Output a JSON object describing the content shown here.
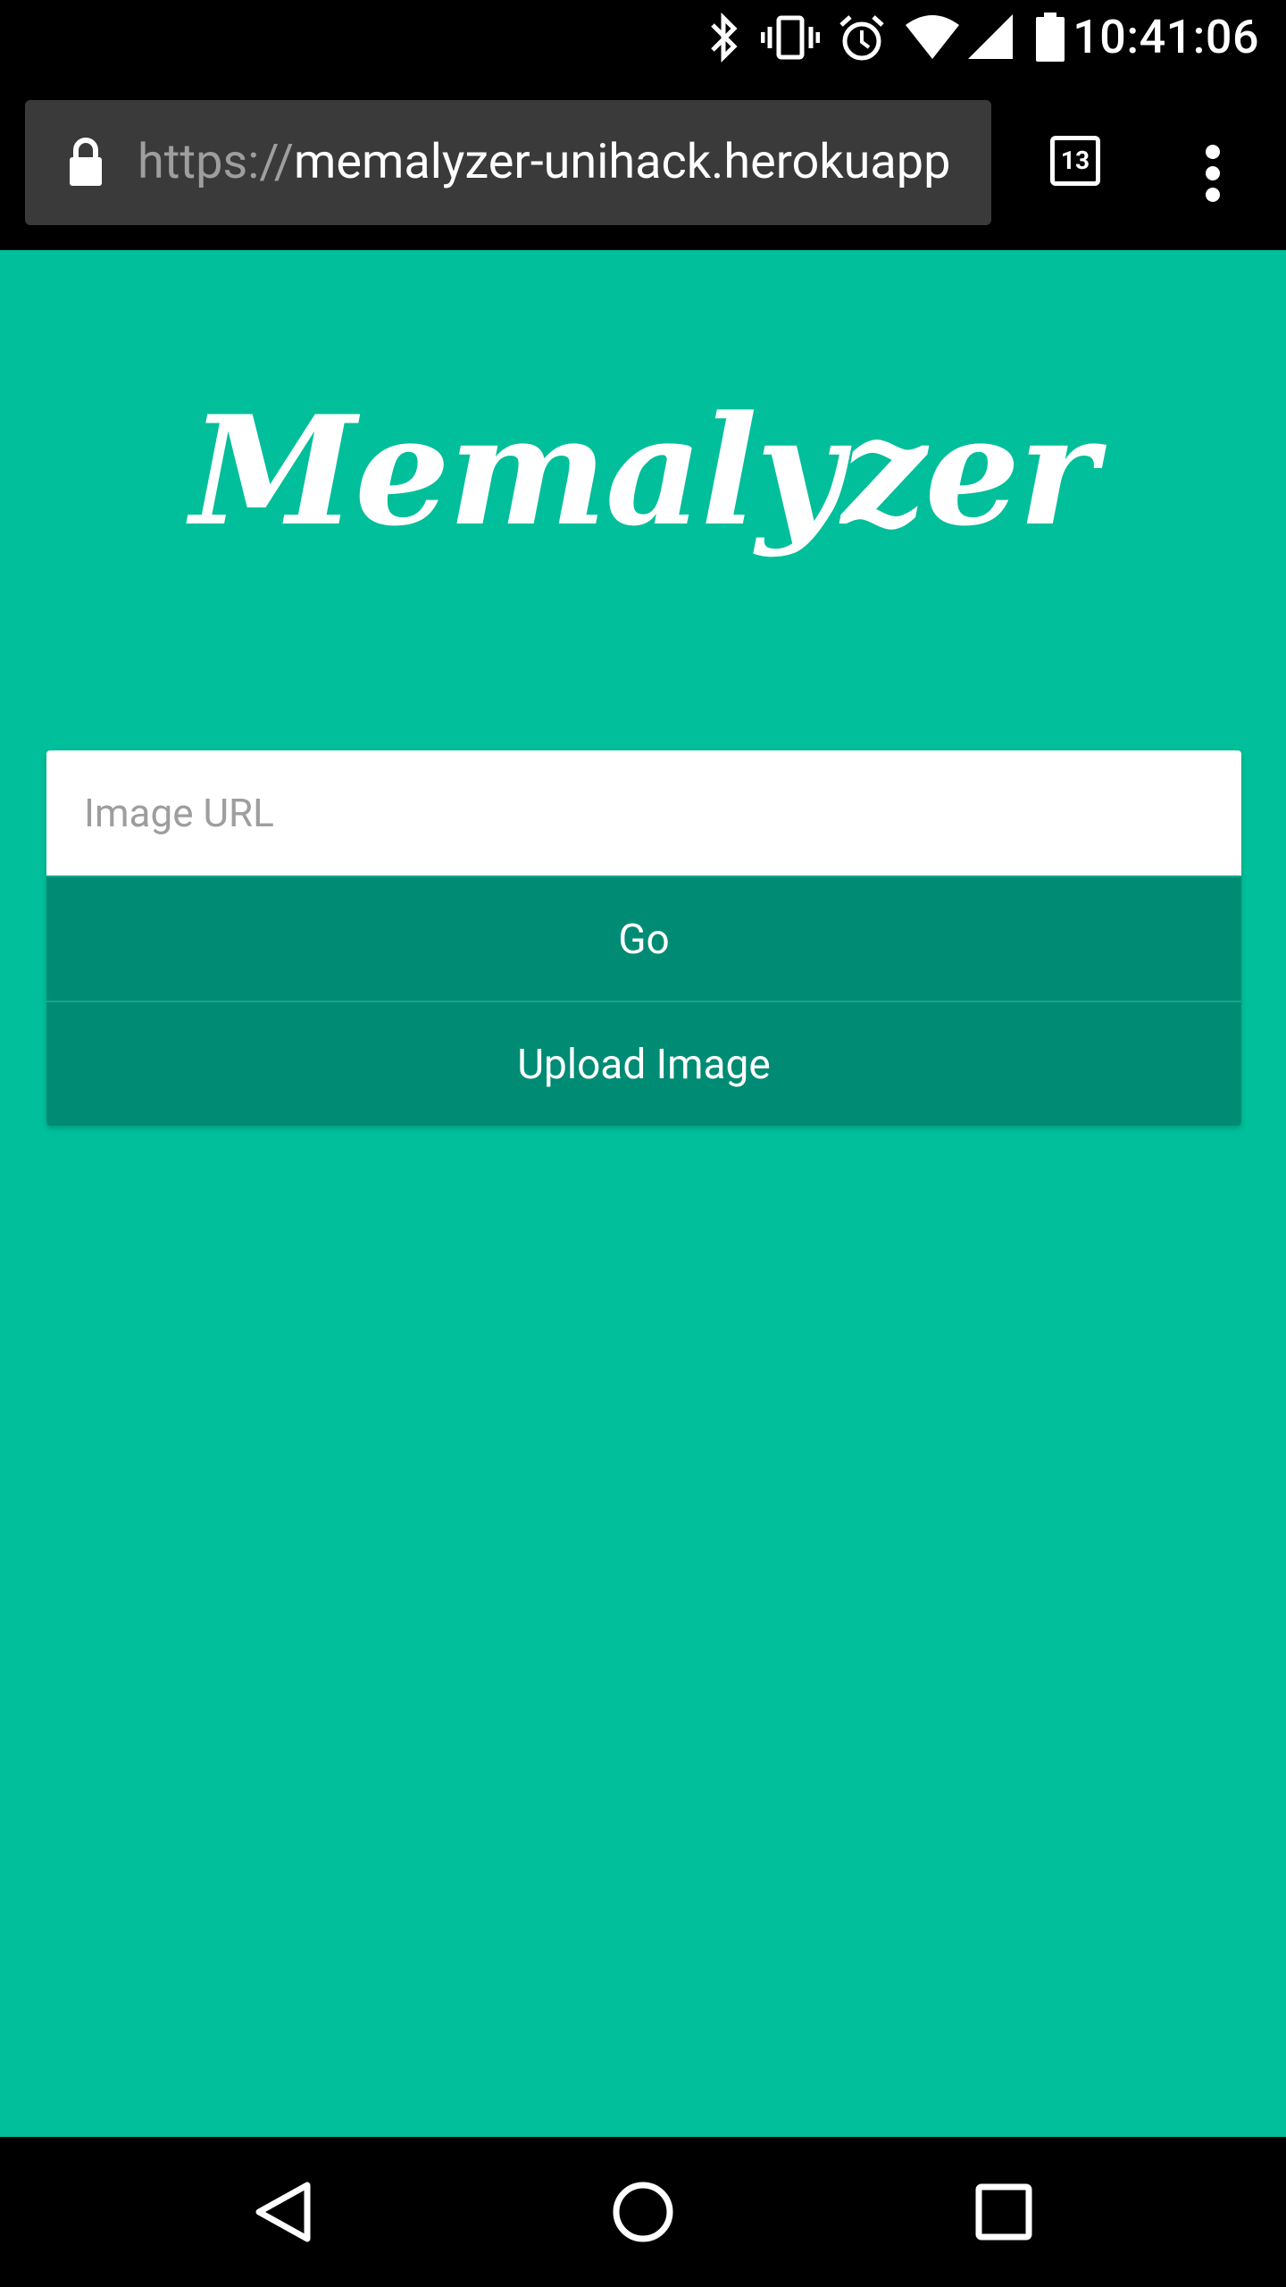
{
  "status_bar": {
    "time": "10:41:06",
    "icons": [
      "bluetooth-icon",
      "vibrate-icon",
      "alarm-icon",
      "wifi-icon",
      "signal-icon",
      "battery-icon"
    ]
  },
  "browser": {
    "url_scheme": "https://",
    "url_host": "memalyzer-unihack.herokuapp",
    "tab_count": "13",
    "icons": [
      "lock-icon",
      "tabs-icon",
      "more-vert-icon"
    ]
  },
  "page": {
    "logo": "Memalyzer",
    "background_color": "#00bf9a",
    "button_color": "#008b74",
    "input": {
      "value": "",
      "placeholder": "Image URL"
    },
    "go_label": "Go",
    "upload_label": "Upload Image"
  },
  "nav_bar": {
    "icons": [
      "back-icon",
      "home-icon",
      "recents-icon"
    ]
  }
}
